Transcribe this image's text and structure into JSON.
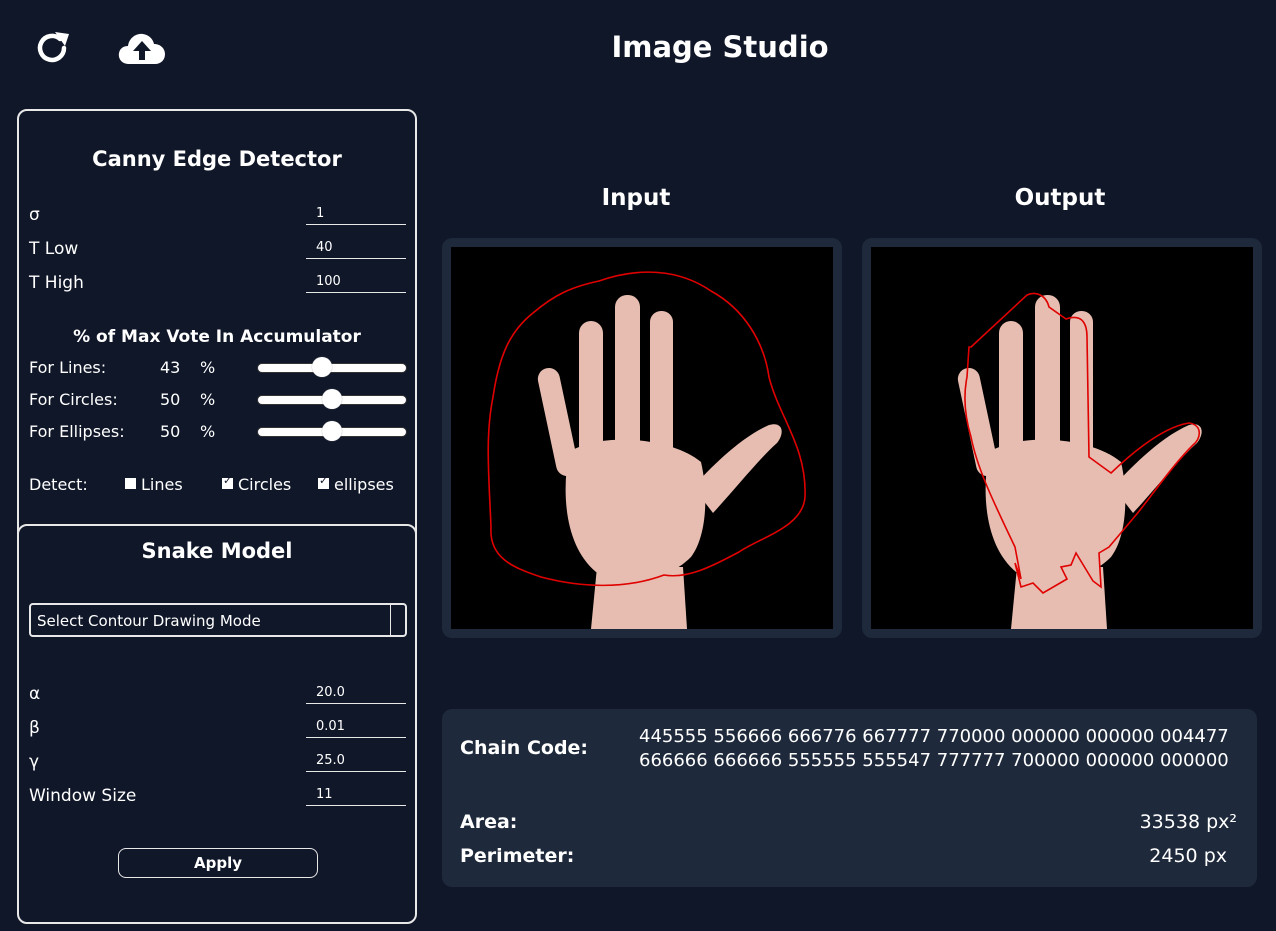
{
  "header": {
    "title": "Image Studio",
    "reload_icon": "reload-icon",
    "upload_icon": "cloud-upload-icon"
  },
  "canny": {
    "title": "Canny Edge Detector",
    "sigma": {
      "label": "σ",
      "value": "1"
    },
    "t_low": {
      "label": "T Low",
      "value": "40"
    },
    "t_high": {
      "label": "T High",
      "value": "100"
    }
  },
  "accumulator": {
    "title": "% of Max Vote In Accumulator",
    "percent_sign": "%",
    "lines": {
      "label": "For Lines:",
      "value": "43",
      "level": 43
    },
    "circles": {
      "label": "For Circles:",
      "value": "50",
      "level": 50
    },
    "ellipses": {
      "label": "For Ellipses:",
      "value": "50",
      "level": 50
    }
  },
  "detect": {
    "label": "Detect:",
    "options": [
      {
        "label": "Lines",
        "checked": false
      },
      {
        "label": "Circles",
        "checked": true
      },
      {
        "label": "ellipses",
        "checked": true
      }
    ]
  },
  "snake": {
    "title": "Snake Model",
    "mode_select": "Select Contour Drawing Mode",
    "alpha": {
      "label": "α",
      "value": "20.0"
    },
    "beta": {
      "label": "β",
      "value": "0.01"
    },
    "gamma": {
      "label": "γ",
      "value": "25.0"
    },
    "window_size": {
      "label": "Window Size",
      "value": "11"
    },
    "apply_label": "Apply"
  },
  "images": {
    "input_title": "Input",
    "output_title": "Output"
  },
  "results": {
    "chain_code_label": "Chain Code:",
    "chain_code_line1": "445555 556666 666776 667777 770000 000000 000000 004477",
    "chain_code_line2": "666666 666666 555555 555547 777777 700000 000000 000000",
    "area_label": "Area:",
    "area_value": "33538 px²",
    "perimeter_label": "Perimeter:",
    "perimeter_value": "2450 px"
  },
  "colors": {
    "background": "#101729",
    "card": "#1e293b",
    "contour": "#e00000"
  }
}
